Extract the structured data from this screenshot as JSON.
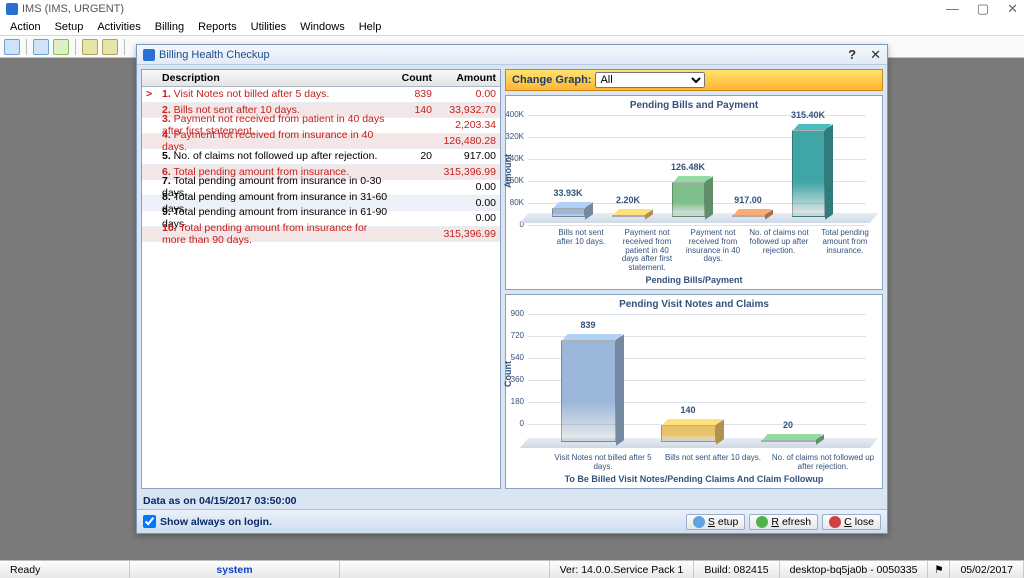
{
  "window": {
    "title": "IMS (IMS, URGENT)"
  },
  "menu": {
    "items": [
      "Action",
      "Setup",
      "Activities",
      "Billing",
      "Reports",
      "Utilities",
      "Windows",
      "Help"
    ]
  },
  "dialog": {
    "title": "Billing Health Checkup",
    "graph": {
      "label": "Change Graph:",
      "selected": "All"
    },
    "data_as": "Data as on 04/15/2017 03:50:00",
    "show_always": "Show always on login.",
    "buttons": {
      "setup": "Setup",
      "refresh": "Refresh",
      "close": "Close"
    }
  },
  "table": {
    "headers": {
      "desc": "Description",
      "count": "Count",
      "amount": "Amount"
    },
    "rows": [
      {
        "n": "1.",
        "desc": "Visit Notes not billed after 5 days.",
        "count": "839",
        "amount": "0.00",
        "red": true,
        "caret": true
      },
      {
        "n": "2.",
        "desc": "Bills not sent after 10 days.",
        "count": "140",
        "amount": "33,932.70",
        "red": true
      },
      {
        "n": "3.",
        "desc": "Payment not received from patient in 40 days after first statement.",
        "count": "",
        "amount": "2,203.34",
        "red": true
      },
      {
        "n": "4.",
        "desc": "Payment not received from insurance in 40 days.",
        "count": "",
        "amount": "126,480.28",
        "red": true
      },
      {
        "n": "5.",
        "desc": "No. of claims not followed up after rejection.",
        "count": "20",
        "amount": "917.00",
        "red": false
      },
      {
        "n": "6.",
        "desc": "Total pending amount from insurance.",
        "count": "",
        "amount": "315,396.99",
        "red": true
      },
      {
        "n": "7.",
        "desc": "Total pending amount from insurance in 0-30 days.",
        "count": "",
        "amount": "0.00",
        "red": false
      },
      {
        "n": "8.",
        "desc": "Total pending amount from insurance in 31-60 days.",
        "count": "",
        "amount": "0.00",
        "red": false
      },
      {
        "n": "9.",
        "desc": "Total pending amount from insurance in 61-90 days.",
        "count": "",
        "amount": "0.00",
        "red": false
      },
      {
        "n": "10.",
        "desc": "Total pending amount from insurance for more than 90 days.",
        "count": "",
        "amount": "315,396.99",
        "red": true
      }
    ]
  },
  "chart_data": [
    {
      "type": "bar",
      "title": "Pending Bills and Payment",
      "ylabel": "Amount",
      "xlabel": "Pending Bills/Payment",
      "ylim": [
        0,
        400000
      ],
      "ticks": [
        "0",
        "80K",
        "160K",
        "240K",
        "320K",
        "400K"
      ],
      "categories": [
        "Bills not sent after 10 days.",
        "Payment not received from patient in 40 days after first statement.",
        "Payment not received from insurance in 40 days.",
        "No. of claims not followed up after rejection.",
        "Total pending amount from insurance."
      ],
      "values": [
        33930,
        2200,
        126480,
        917,
        315400
      ],
      "value_labels": [
        "33.93K",
        "2.20K",
        "126.48K",
        "917.00",
        "315.40K"
      ],
      "colors": [
        "#9ab6d8",
        "#e9c36a",
        "#7fbf8c",
        "#e39563",
        "#3fa5a5"
      ]
    },
    {
      "type": "bar",
      "title": "Pending Visit Notes and Claims",
      "ylabel": "Count",
      "xlabel": "To Be Billed Visit Notes/Pending Claims And Claim Followup",
      "ylim": [
        0,
        900
      ],
      "ticks": [
        "0",
        "180",
        "360",
        "540",
        "720",
        "900"
      ],
      "categories": [
        "Visit Notes not billed after 5 days.",
        "Bills not sent after 10 days.",
        "No. of claims not followed up after rejection."
      ],
      "values": [
        839,
        140,
        20
      ],
      "value_labels": [
        "839",
        "140",
        "20"
      ],
      "colors": [
        "#9ab6d8",
        "#e9c36a",
        "#7fbf8c"
      ]
    }
  ],
  "status": {
    "ready": "Ready",
    "user": "system",
    "ver": "Ver: 14.0.0.Service Pack 1",
    "build": "Build: 082415",
    "host": "desktop-bq5ja0b - 0050335",
    "date": "05/02/2017"
  }
}
